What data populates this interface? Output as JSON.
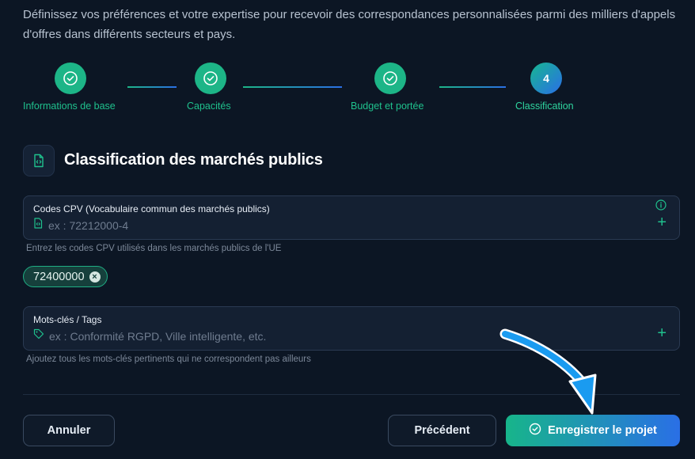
{
  "intro": "Définissez vos préférences et votre expertise pour recevoir des correspondances personnalisées parmi des milliers d'appels d'offres dans différents secteurs et pays.",
  "stepper": {
    "steps": [
      {
        "label": "Informations de base",
        "state": "done"
      },
      {
        "label": "Capacités",
        "state": "done"
      },
      {
        "label": "Budget et portée",
        "state": "done"
      },
      {
        "label": "Classification",
        "state": "active",
        "number": "4"
      }
    ]
  },
  "section": {
    "title": "Classification des marchés publics",
    "icon": "file-code-icon"
  },
  "cpv": {
    "label": "Codes CPV (Vocabulaire commun des marchés publics)",
    "placeholder": "ex : 72212000-4",
    "hint": "Entrez les codes CPV utilisés dans les marchés publics de l'UE",
    "chips": [
      "72400000"
    ]
  },
  "keywords": {
    "label": "Mots-clés / Tags",
    "placeholder": "ex : Conformité RGPD, Ville intelligente, etc.",
    "hint": "Ajoutez tous les mots-clés pertinents qui ne correspondent pas ailleurs"
  },
  "actions": {
    "cancel": "Annuler",
    "previous": "Précédent",
    "save": "Enregistrer le projet"
  },
  "colors": {
    "accent_green": "#1db587",
    "accent_blue": "#2a6fe6",
    "background": "#0c1624"
  }
}
